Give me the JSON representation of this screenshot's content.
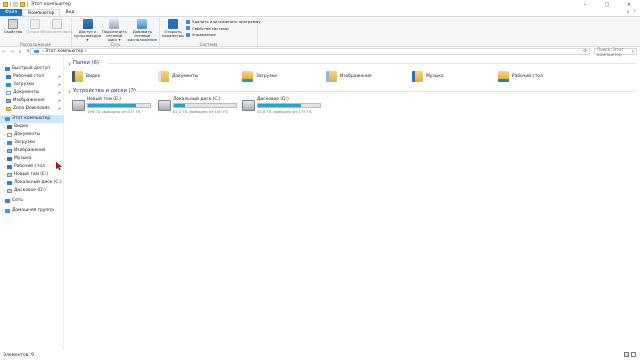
{
  "window": {
    "title": "Этот компьютер",
    "controls": {
      "minimize": "–",
      "maximize": "□",
      "close": "✕"
    }
  },
  "tabs": [
    {
      "label": "Файл"
    },
    {
      "label": "Компьютер"
    },
    {
      "label": "Вид"
    }
  ],
  "tabs_right": {
    "collapse": "∨",
    "help": "?"
  },
  "ribbon": {
    "groups": [
      {
        "name": "Расположение",
        "buttons": [
          {
            "label": "Свойства"
          },
          {
            "label": "Открыть"
          },
          {
            "label": "Переименовать"
          }
        ]
      },
      {
        "name": "Сеть",
        "buttons": [
          {
            "label": "Доступ к мультимедиа ▾"
          },
          {
            "label": "Подключить сетевой диск ▾"
          },
          {
            "label": "Добавить сетевое расположение"
          }
        ]
      },
      {
        "name": "Система",
        "buttons": [
          {
            "label": "Открыть параметры"
          }
        ],
        "small": [
          {
            "label": "Удалить или изменить программу"
          },
          {
            "label": "Свойства системы"
          },
          {
            "label": "Управление"
          }
        ]
      }
    ]
  },
  "address": {
    "back": "←",
    "forward": "→",
    "up_history": "∨",
    "up": "↑",
    "path": "› Этот компьютер ›",
    "refresh": "⟳",
    "search_placeholder": "Поиск: Этот компьютер",
    "search_icon": "search-icon"
  },
  "nav": {
    "items": [
      {
        "label": "Быстрый доступ",
        "icon": "star-icon"
      },
      {
        "label": "Рабочий стол",
        "icon": "desktop-icon",
        "pin": "✦"
      },
      {
        "label": "Загрузки",
        "icon": "download-icon",
        "pin": "✦"
      },
      {
        "label": "Документы",
        "icon": "document-icon",
        "pin": "✦"
      },
      {
        "label": "Изображения",
        "icon": "pictures-icon",
        "pin": "✦"
      },
      {
        "label": "Zona Downloads",
        "icon": "folder-icon",
        "pin": "✦"
      },
      {
        "label": "Этот компьютер",
        "icon": "computer-icon"
      },
      {
        "label": "Видео",
        "icon": "video-icon"
      },
      {
        "label": "Документы",
        "icon": "document-icon"
      },
      {
        "label": "Загрузки",
        "icon": "download-icon"
      },
      {
        "label": "Изображения",
        "icon": "pictures-icon"
      },
      {
        "label": "Музыка",
        "icon": "music-icon"
      },
      {
        "label": "Рабочий стол",
        "icon": "desktop-icon"
      },
      {
        "label": "Новый том (E:)",
        "icon": "drive-icon"
      },
      {
        "label": "Локальный диск (C:)",
        "icon": "windows-drive-icon"
      },
      {
        "label": "Дисковое (D:)",
        "icon": "drive-icon"
      },
      {
        "label": "Сеть",
        "icon": "network-icon"
      },
      {
        "label": "Домашняя группа",
        "icon": "homegroup-icon"
      }
    ]
  },
  "folders_section": {
    "title": "Папки (6)",
    "toggle": "∨"
  },
  "folders": [
    {
      "label": "Видео",
      "icon": "video-folder-icon"
    },
    {
      "label": "Документы",
      "icon": "documents-folder-icon"
    },
    {
      "label": "Загрузки",
      "icon": "downloads-folder-icon"
    },
    {
      "label": "Изображения",
      "icon": "pictures-folder-icon"
    },
    {
      "label": "Музыка",
      "icon": "music-folder-icon"
    },
    {
      "label": "Рабочий стол",
      "icon": "desktop-folder-icon"
    }
  ],
  "drives_section": {
    "title": "Устройства и диски (3)",
    "toggle": "∨"
  },
  "drives": [
    {
      "name": "Новый том (E:)",
      "free": "196 ГБ свободно из 837 ГБ",
      "used_fraction": 0.77,
      "icon": "hard-drive-icon"
    },
    {
      "name": "Локальный диск (C:)",
      "free": "82,2 ГБ свободно из 100 ГБ",
      "used_fraction": 0.18,
      "icon": "system-drive-icon"
    },
    {
      "name": "Дисковое (D:)",
      "free": "52,8 ГБ свободно из 177 ГБ",
      "used_fraction": 0.7,
      "icon": "hard-drive-icon"
    }
  ],
  "status": {
    "text": "Элементов: 9"
  },
  "colors": {
    "accent": "#1979ca",
    "selection": "#cce8ff",
    "drive_bar": "#26a0da",
    "section_title": "#1e3287"
  }
}
